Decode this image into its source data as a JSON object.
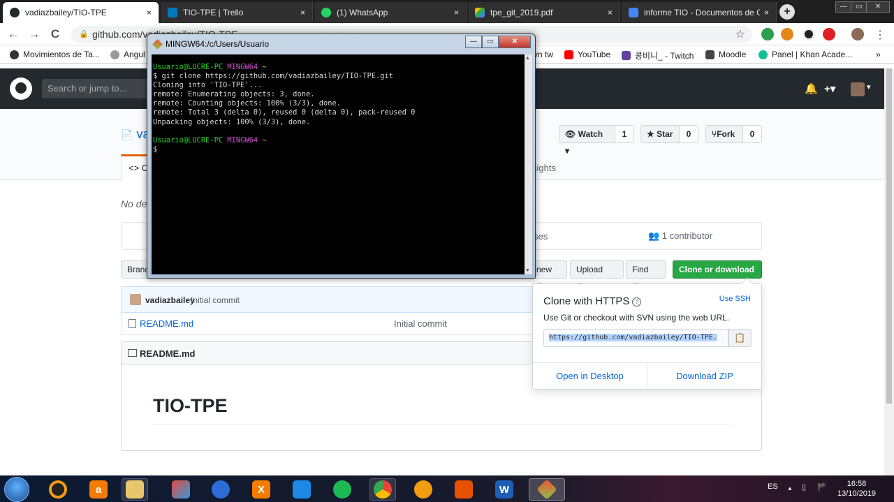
{
  "browser": {
    "tabs": [
      {
        "label": "vadiazbailey/TIO-TPE",
        "close": "×",
        "favicon": "github-icon",
        "active": true
      },
      {
        "label": "TIO-TPE | Trello",
        "close": "×",
        "favicon": "trello-icon"
      },
      {
        "label": "(1) WhatsApp",
        "close": "×",
        "favicon": "whatsapp-icon"
      },
      {
        "label": "tpe_git_2019.pdf",
        "close": "×",
        "favicon": "drive-icon"
      },
      {
        "label": "informe TIO - Documentos de G",
        "close": "×",
        "favicon": "docs-icon"
      }
    ],
    "new_tab": "+",
    "window_controls": [
      "—",
      "▭",
      "✕"
    ],
    "nav": {
      "back": "←",
      "forward": "→",
      "reload": "C"
    },
    "url": "github.com/vadiazbailey/TIO-TPE",
    "bookmarks": [
      "Movimientos de Ta...",
      "Angul",
      "vn tw",
      "YouTube",
      "콩비니_ - Twitch",
      "Moodle",
      "Panel | Khan Acade..."
    ],
    "bookmarks_more": "»"
  },
  "github": {
    "search_placeholder": "Search or jump to...",
    "header_icons": {
      "bell": "🔔",
      "plus": "+▾",
      "avatar_caret": "▾"
    },
    "repo_name": "vad",
    "watch": {
      "label": "Watch ▾",
      "count": "1"
    },
    "star": {
      "label": "Star",
      "count": "0"
    },
    "fork": {
      "label": "Fork",
      "count": "0"
    },
    "code_tab": "<> C",
    "insights_tab": "sights",
    "description": "No de",
    "summary": {
      "licenses": "ses",
      "contributors": "1 contributor"
    },
    "buttons": {
      "branch": "Branc",
      "new_file": "new file",
      "upload": "Upload files",
      "find": "Find file",
      "clone": "Clone or download ▾"
    },
    "commit": {
      "author": "vadiazbailey",
      "message": "Initial commit"
    },
    "files": [
      {
        "name": "README.md",
        "message": "Initial commit"
      }
    ],
    "readme": {
      "label": "README.md",
      "heading": "TIO-TPE"
    },
    "clone_panel": {
      "title": "Clone with HTTPS",
      "help": "?",
      "use_ssh": "Use SSH",
      "hint": "Use Git or checkout with SVN using the web URL.",
      "url": "https://github.com/vadiazbailey/TIO-TPE.",
      "copy": "📋",
      "open_desktop": "Open in Desktop",
      "download_zip": "Download ZIP"
    }
  },
  "terminal": {
    "title": "MINGW64:/c/Users/Usuario",
    "user_host": "Usuario@LUCRE-PC",
    "shell": "MINGW64",
    "cwd": "~",
    "command": "$ git clone https://github.com/vadiazbailey/TIO-TPE.git",
    "output": [
      "Cloning into 'TIO-TPE'...",
      "remote: Enumerating objects: 3, done.",
      "remote: Counting objects: 100% (3/3), done.",
      "remote: Total 3 (delta 0), reused 0 (delta 0), pack-reused 0",
      "Unpacking objects: 100% (3/3), done."
    ],
    "prompt_end": "$",
    "controls": [
      "—",
      "▭",
      "✕"
    ]
  },
  "taskbar": {
    "language": "ES",
    "time": "16:58",
    "date": "13/10/2019",
    "tray_arrow": "▲",
    "tray_flag": "🏴"
  },
  "colors": {
    "github_header": "#24292e",
    "clone_green": "#28a745",
    "link_blue": "#0366d6",
    "term_green": "#28d428",
    "term_magenta": "#d04fd0",
    "term_yellow": "#d9c52b"
  }
}
